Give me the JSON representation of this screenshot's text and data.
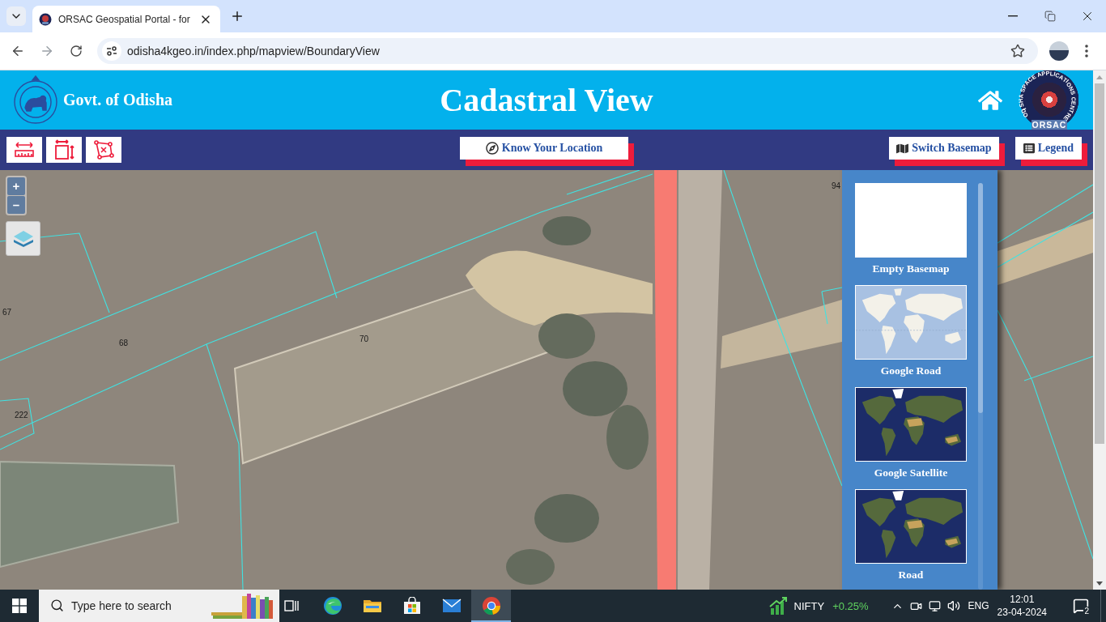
{
  "browser": {
    "tab": {
      "title": "ORSAC Geospatial Portal - for"
    },
    "address": "odisha4kgeo.in/index.php/mapview/BoundaryView"
  },
  "header": {
    "govt_label": "Govt. of Odisha",
    "title": "Cadastral View",
    "logo": {
      "ring_text": "ODISHA SPACE APPLICATIONS CENTRE",
      "caption": "ORSAC"
    }
  },
  "toolbar": {
    "tools": [
      {
        "kind": "measure-length"
      },
      {
        "kind": "measure-area"
      },
      {
        "kind": "clear"
      }
    ],
    "locate_button": "Know Your Location",
    "basemap_button": "Switch Basemap",
    "legend_button": "Legend"
  },
  "map": {
    "zoom_in": "+",
    "zoom_out": "–",
    "parcel_labels": [
      "94",
      "67",
      "68",
      "70",
      "222"
    ],
    "basemap_panel": {
      "items": [
        {
          "label": "Empty Basemap",
          "kind": "empty"
        },
        {
          "label": "Google Road",
          "kind": "road"
        },
        {
          "label": "Google Satellite",
          "kind": "satellite"
        },
        {
          "label": "Road",
          "kind": "satellite"
        }
      ]
    }
  },
  "taskbar": {
    "search_placeholder": "Type here to search",
    "apps": [
      {
        "kind": "task-view",
        "selected": false
      },
      {
        "kind": "edge",
        "selected": false
      },
      {
        "kind": "explorer",
        "selected": false
      },
      {
        "kind": "store",
        "selected": false
      },
      {
        "kind": "mail",
        "selected": false
      },
      {
        "kind": "chrome",
        "selected": true
      }
    ],
    "ticker": {
      "name": "NIFTY",
      "change": "+0.25%"
    },
    "language": "ENG",
    "time": "12:01",
    "date": "23-04-2024",
    "notification_count": "2"
  }
}
